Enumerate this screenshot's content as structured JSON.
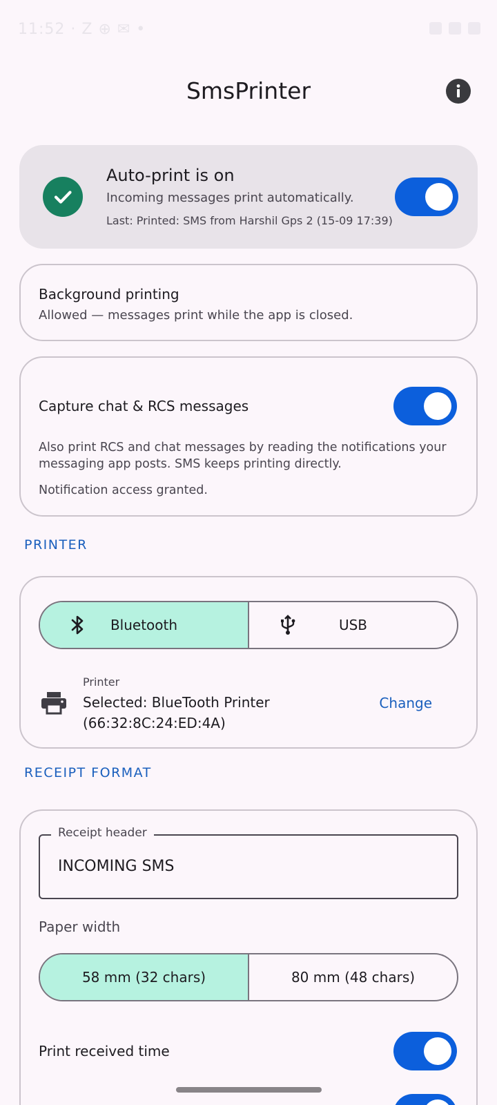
{
  "status_bar": {
    "time": "11:52 · Z ⊕ ✉ •"
  },
  "app_bar": {
    "title": "SmsPrinter",
    "info_icon": "info-icon"
  },
  "auto_print": {
    "title": "Auto-print is on",
    "description": "Incoming messages print automatically.",
    "last": "Last: Printed: SMS from Harshil Gps 2 (15-09 17:39)",
    "enabled": true,
    "icon": "check-circle-icon",
    "accent": "#17805f"
  },
  "background_printing": {
    "title": "Background printing",
    "description": "Allowed — messages print while the app is closed."
  },
  "capture": {
    "title": "Capture chat & RCS messages",
    "description": "Also print RCS and chat messages by reading the notifications your messaging app posts. SMS keeps printing directly.",
    "status": "Notification access granted.",
    "enabled": true
  },
  "printer_section": {
    "label": "PRINTER",
    "connection_options": [
      {
        "label": "Bluetooth",
        "icon": "bluetooth-icon",
        "selected": true
      },
      {
        "label": "USB",
        "icon": "usb-icon",
        "selected": false
      }
    ],
    "printer_label": "Printer",
    "selected_printer": "Selected: BlueTooth Printer (66:32:8C:24:ED:4A)",
    "change_label": "Change"
  },
  "receipt_section": {
    "label": "RECEIPT FORMAT",
    "header_field_label": "Receipt header",
    "header_field_value": "INCOMING SMS",
    "paper_width_label": "Paper width",
    "paper_width_options": [
      {
        "label": "58 mm (32 chars)",
        "selected": true
      },
      {
        "label": "80 mm (48 chars)",
        "selected": false
      }
    ],
    "print_received_time_label": "Print received time",
    "print_received_time_enabled": true
  },
  "colors": {
    "toggle_on": "#0c5fdc",
    "segment_selected": "#b6f2e0",
    "section_label": "#1a5fbd"
  }
}
